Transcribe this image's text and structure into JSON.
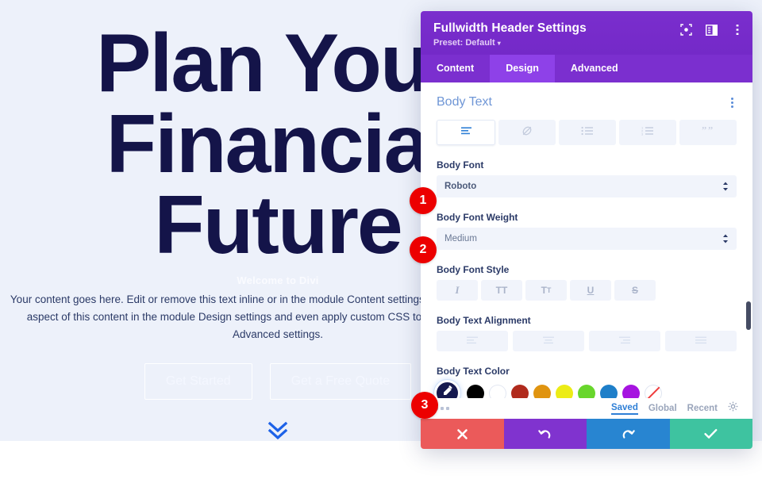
{
  "page": {
    "background_color": "#edf1fa",
    "hero": {
      "title_lines": [
        "Plan Your",
        "Financial",
        "Future"
      ],
      "title_color": "#141449",
      "subtitle": "Welcome to Divi",
      "paragraph": "Your content goes here. Edit or remove this text inline or in the module Content settings. You can also style every aspect of this content in the module Design settings and even apply custom CSS to this text in the module Advanced settings.",
      "buttons": [
        {
          "label": "Get Started"
        },
        {
          "label": "Get a Free Quote"
        }
      ],
      "scroll_icon": "double-chevron-down-icon",
      "scroll_icon_color": "#1d62e8"
    }
  },
  "modal": {
    "title": "Fullwidth Header Settings",
    "preset_label": "Preset: Default",
    "preset_caret": "▾",
    "header_color": "#7b2fcf",
    "header_icons": [
      {
        "name": "focus-mode-icon"
      },
      {
        "name": "layout-panel-icon"
      },
      {
        "name": "more-options-icon"
      }
    ],
    "tabs": [
      {
        "label": "Content",
        "active": false
      },
      {
        "label": "Design",
        "active": true
      },
      {
        "label": "Advanced",
        "active": false
      }
    ],
    "section": {
      "title": "Body Text",
      "options_icon": "vertical-dots-icon",
      "text_type_buttons": [
        {
          "name": "paragraph-icon",
          "active": true
        },
        {
          "name": "link-icon",
          "active": false
        },
        {
          "name": "unordered-list-icon",
          "active": false
        },
        {
          "name": "ordered-list-icon",
          "active": false
        },
        {
          "name": "blockquote-icon",
          "active": false
        }
      ],
      "fields": {
        "body_font": {
          "label": "Body Font",
          "value": "Roboto"
        },
        "body_font_weight": {
          "label": "Body Font Weight",
          "value": "Medium"
        },
        "body_font_style": {
          "label": "Body Font Style",
          "buttons": [
            {
              "name": "italic-icon",
              "glyph": "I"
            },
            {
              "name": "uppercase-icon",
              "glyph": "TT"
            },
            {
              "name": "smallcaps-icon",
              "glyph": "T"
            },
            {
              "name": "underline-icon",
              "glyph": "U"
            },
            {
              "name": "strikethrough-icon",
              "glyph": "S"
            }
          ]
        },
        "body_text_alignment": {
          "label": "Body Text Alignment",
          "buttons": [
            {
              "name": "align-left-icon"
            },
            {
              "name": "align-center-icon"
            },
            {
              "name": "align-right-icon"
            },
            {
              "name": "align-justify-icon"
            }
          ]
        },
        "body_text_color": {
          "label": "Body Text Color",
          "picker_icon": "eyedropper-icon",
          "picker_bg": "#16194f",
          "swatches": [
            {
              "name": "swatch-black",
              "color": "#000000"
            },
            {
              "name": "swatch-white",
              "color": "#ffffff"
            },
            {
              "name": "swatch-dark-red",
              "color": "#b02a1d"
            },
            {
              "name": "swatch-orange",
              "color": "#e09410"
            },
            {
              "name": "swatch-yellow",
              "color": "#ecec16"
            },
            {
              "name": "swatch-green",
              "color": "#68d62c"
            },
            {
              "name": "swatch-blue",
              "color": "#1e7fc9"
            },
            {
              "name": "swatch-purple",
              "color": "#a614e0"
            },
            {
              "name": "swatch-transparent",
              "color": "transparent"
            }
          ]
        }
      }
    },
    "palette_bar": {
      "more_icon": "horizontal-dots-icon",
      "tabs": [
        {
          "label": "Saved",
          "active": true
        },
        {
          "label": "Global",
          "active": false
        },
        {
          "label": "Recent",
          "active": false
        }
      ],
      "settings_icon": "gear-icon"
    },
    "actions": [
      {
        "name": "cancel-button",
        "icon": "close-icon",
        "color": "#eb5a5a"
      },
      {
        "name": "undo-button",
        "icon": "undo-icon",
        "color": "#8033cf"
      },
      {
        "name": "redo-button",
        "icon": "redo-icon",
        "color": "#2885d1"
      },
      {
        "name": "save-button",
        "icon": "check-icon",
        "color": "#3ec3a0"
      }
    ],
    "scrollbar": {
      "name": "vertical-scrollbar-thumb",
      "color": "#454c63"
    }
  },
  "step_badges": [
    {
      "number": "1"
    },
    {
      "number": "2"
    },
    {
      "number": "3"
    }
  ]
}
